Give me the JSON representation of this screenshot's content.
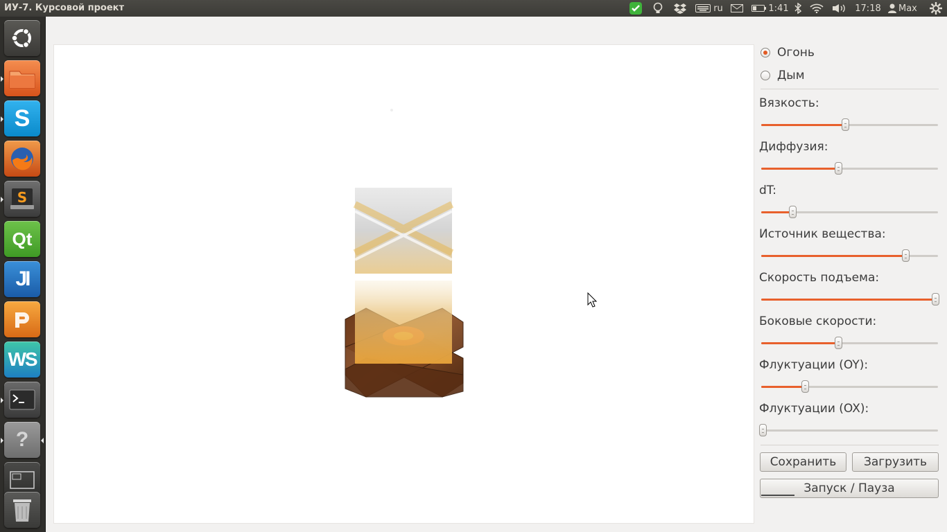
{
  "window": {
    "title": "ИУ-7. Курсовой проект"
  },
  "topbar": {
    "keyboard_layout": "ru",
    "battery_time": "1:41",
    "clock": "17:18",
    "user": "Max",
    "icons": [
      "checkmark-shield-icon",
      "lightbulb-icon",
      "dropbox-icon",
      "keyboard-icon",
      "mail-icon",
      "battery-icon",
      "bluetooth-icon",
      "wifi-icon",
      "volume-icon",
      "user-icon",
      "gear-icon"
    ]
  },
  "launcher": {
    "items": [
      "ubuntu-dash",
      "files",
      "skype",
      "firefox",
      "sublime-text",
      "qt-creator",
      "intellij-idea",
      "phpstorm",
      "webstorm",
      "terminal",
      "help",
      "workspace-switcher",
      "trash"
    ]
  },
  "controls": {
    "mode": {
      "options": [
        {
          "label": "Огонь",
          "selected": true
        },
        {
          "label": "Дым",
          "selected": false
        }
      ]
    },
    "sliders": [
      {
        "label": "Вязкость:",
        "value": 0.48
      },
      {
        "label": "Диффузия:",
        "value": 0.44
      },
      {
        "label": "dT:",
        "value": 0.18
      },
      {
        "label": "Источник вещества:",
        "value": 0.82
      },
      {
        "label": "Скорость подъема:",
        "value": 0.99
      },
      {
        "label": "Боковые скорости:",
        "value": 0.44
      },
      {
        "label": "Флуктуации (OY):",
        "value": 0.25
      },
      {
        "label": "Флуктуации (OX):",
        "value": 0.01
      }
    ],
    "buttons": {
      "save": "Сохранить",
      "load": "Загрузить",
      "run_pause": "Запуск / Пауза"
    }
  },
  "colors": {
    "accent": "#e8602c",
    "panel": "#3c3b37",
    "launcher": "#2f2e2b"
  }
}
